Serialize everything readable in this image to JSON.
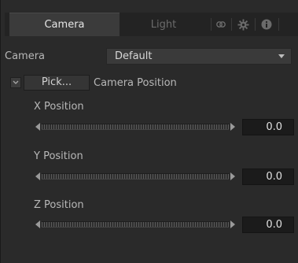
{
  "tabs": [
    {
      "label": "Camera",
      "active": true
    },
    {
      "label": "Light",
      "active": false
    }
  ],
  "tab_icons": [
    "link-icon",
    "gear-icon",
    "info-icon"
  ],
  "camera": {
    "label": "Camera",
    "selected": "Default"
  },
  "pick": {
    "button_label": "Pick...",
    "label": "Camera Position"
  },
  "positions": [
    {
      "label": "X Position",
      "value": "0.0"
    },
    {
      "label": "Y Position",
      "value": "0.0"
    },
    {
      "label": "Z Position",
      "value": "0.0"
    }
  ],
  "colors": {
    "background": "#2a2a2a",
    "tab_active": "#3b3b3b",
    "field": "#1b1b1b"
  }
}
